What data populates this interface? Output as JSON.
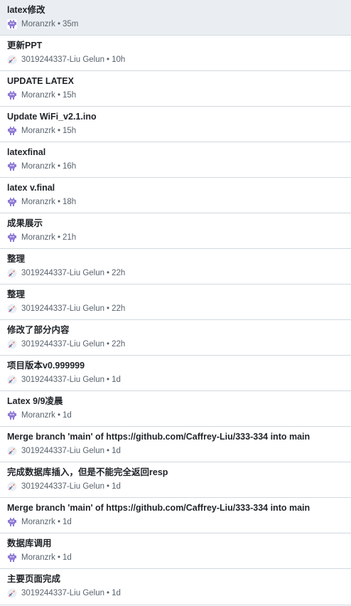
{
  "separator": "•",
  "commits": [
    {
      "message": "latex修改",
      "author": "Moranzrk",
      "time": "35m",
      "avatar": "robot-avatar-icon",
      "selected": true
    },
    {
      "message": "更新PPT",
      "author": "3019244337-Liu Gelun",
      "time": "10h",
      "avatar": "rocket-avatar-icon"
    },
    {
      "message": "UPDATE LATEX",
      "author": "Moranzrk",
      "time": "15h",
      "avatar": "robot-avatar-icon"
    },
    {
      "message": "Update WiFi_v2.1.ino",
      "author": "Moranzrk",
      "time": "15h",
      "avatar": "robot-avatar-icon"
    },
    {
      "message": "latexfinal",
      "author": "Moranzrk",
      "time": "16h",
      "avatar": "robot-avatar-icon"
    },
    {
      "message": "latex v.final",
      "author": "Moranzrk",
      "time": "18h",
      "avatar": "robot-avatar-icon"
    },
    {
      "message": "成果展示",
      "author": "Moranzrk",
      "time": "21h",
      "avatar": "robot-avatar-icon"
    },
    {
      "message": "整理",
      "author": "3019244337-Liu Gelun",
      "time": "22h",
      "avatar": "rocket-avatar-icon"
    },
    {
      "message": "整理",
      "author": "3019244337-Liu Gelun",
      "time": "22h",
      "avatar": "rocket-avatar-icon"
    },
    {
      "message": "修改了部分内容",
      "author": "3019244337-Liu Gelun",
      "time": "22h",
      "avatar": "rocket-avatar-icon"
    },
    {
      "message": "项目版本v0.999999",
      "author": "3019244337-Liu Gelun",
      "time": "1d",
      "avatar": "rocket-avatar-icon"
    },
    {
      "message": "Latex 9/9凌晨",
      "author": "Moranzrk",
      "time": "1d",
      "avatar": "robot-avatar-icon"
    },
    {
      "message": "Merge branch 'main' of https://github.com/Caffrey-Liu/333-334 into main",
      "author": "3019244337-Liu Gelun",
      "time": "1d",
      "avatar": "rocket-avatar-icon"
    },
    {
      "message": "完成数据库插入，但是不能完全返回resp",
      "author": "3019244337-Liu Gelun",
      "time": "1d",
      "avatar": "rocket-avatar-icon"
    },
    {
      "message": "Merge branch 'main' of https://github.com/Caffrey-Liu/333-334 into main",
      "author": "Moranzrk",
      "time": "1d",
      "avatar": "robot-avatar-icon"
    },
    {
      "message": "数据库调用",
      "author": "Moranzrk",
      "time": "1d",
      "avatar": "robot-avatar-icon"
    },
    {
      "message": "主要页面完成",
      "author": "3019244337-Liu Gelun",
      "time": "1d",
      "avatar": "rocket-avatar-icon"
    }
  ]
}
